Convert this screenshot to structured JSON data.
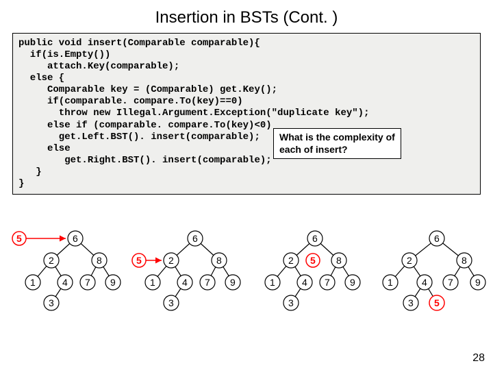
{
  "title": "Insertion in BSTs (Cont. )",
  "code": "public void insert(Comparable comparable){\n  if(is.Empty())\n     attach.Key(comparable);\n  else {\n     Comparable key = (Comparable) get.Key();\n     if(comparable. compare.To(key)==0)\n       throw new Illegal.Argument.Exception(\"duplicate key\");\n     else if (comparable. compare.To(key)<0)\n       get.Left.BST(). insert(comparable);\n     else\n        get.Right.BST(). insert(comparable);\n   }\n}",
  "callout": {
    "line1": "What is the complexity of",
    "line2": "each of insert?"
  },
  "pagenum": "28",
  "trees": {
    "t1": {
      "insertLabel": "5",
      "n6": "6",
      "n2": "2",
      "n8": "8",
      "n1": "1",
      "n4": "4",
      "n7": "7",
      "n9": "9",
      "n3": "3"
    },
    "t2": {
      "insertLabel": "5",
      "n6": "6",
      "n2": "2",
      "n8": "8",
      "n1": "1",
      "n4": "4",
      "n7": "7",
      "n9": "9",
      "n3": "3"
    },
    "t3": {
      "redNode": "5",
      "n6": "6",
      "n2": "2",
      "n8": "8",
      "n1": "1",
      "n4": "4",
      "n7": "7",
      "n9": "9",
      "n3": "3"
    },
    "t4": {
      "red5": "5",
      "n6": "6",
      "n2": "2",
      "n8": "8",
      "n1": "1",
      "n4": "4",
      "n7": "7",
      "n9": "9",
      "n3": "3"
    }
  }
}
